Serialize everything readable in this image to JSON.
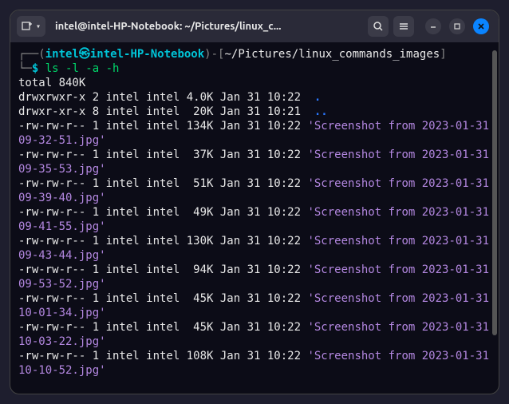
{
  "titlebar": {
    "title": "intel@intel-HP-Notebook: ~/Pictures/linux_c..."
  },
  "prompt": {
    "bracket_open": "┌──(",
    "user": "intel",
    "host_sep": "㉿",
    "host": "intel-HP-Notebook",
    "bracket_close": ")-[",
    "path": "~/Pictures/linux_commands_images",
    "bracket_end": "]",
    "line2_prefix": "└─",
    "symbol": "$",
    "command": " ls -l -a -h"
  },
  "output": {
    "total": "total 840K",
    "rows": [
      {
        "perm": "drwxrwxr-x 2 intel intel 4.0K Jan 31 10:22  ",
        "name": ".",
        "dir": true
      },
      {
        "perm": "drwxr-xr-x 8 intel intel  20K Jan 31 10:21  ",
        "name": "..",
        "dir": true
      },
      {
        "perm": "-rw-rw-r-- 1 intel intel 134K Jan 31 10:22 ",
        "name": "'Screenshot from 2023-01-31 09-32-51.jpg'"
      },
      {
        "perm": "-rw-rw-r-- 1 intel intel  37K Jan 31 10:22 ",
        "name": "'Screenshot from 2023-01-31 09-35-53.jpg'"
      },
      {
        "perm": "-rw-rw-r-- 1 intel intel  51K Jan 31 10:22 ",
        "name": "'Screenshot from 2023-01-31 09-39-40.jpg'"
      },
      {
        "perm": "-rw-rw-r-- 1 intel intel  49K Jan 31 10:22 ",
        "name": "'Screenshot from 2023-01-31 09-41-55.jpg'"
      },
      {
        "perm": "-rw-rw-r-- 1 intel intel 130K Jan 31 10:22 ",
        "name": "'Screenshot from 2023-01-31 09-43-44.jpg'"
      },
      {
        "perm": "-rw-rw-r-- 1 intel intel  94K Jan 31 10:22 ",
        "name": "'Screenshot from 2023-01-31 09-53-52.jpg'"
      },
      {
        "perm": "-rw-rw-r-- 1 intel intel  45K Jan 31 10:22 ",
        "name": "'Screenshot from 2023-01-31 10-01-34.jpg'"
      },
      {
        "perm": "-rw-rw-r-- 1 intel intel  45K Jan 31 10:22 ",
        "name": "'Screenshot from 2023-01-31 10-03-22.jpg'"
      },
      {
        "perm": "-rw-rw-r-- 1 intel intel 108K Jan 31 10:22 ",
        "name": "'Screenshot from 2023-01-31 10-10-52.jpg'"
      }
    ]
  }
}
